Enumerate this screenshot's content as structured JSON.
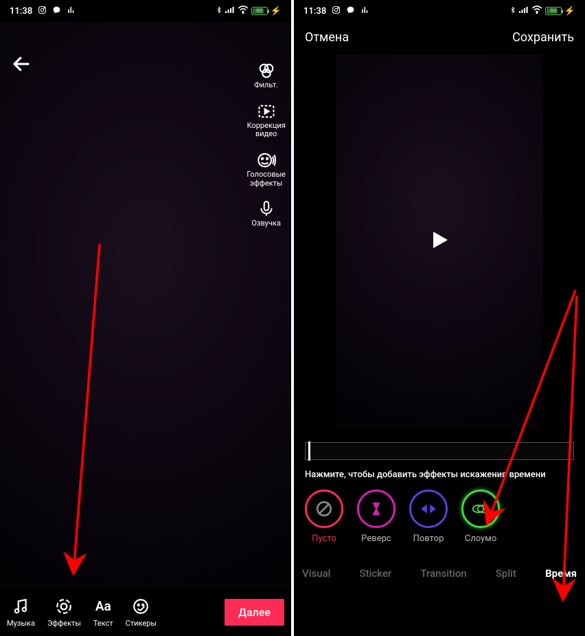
{
  "statusbar": {
    "time": "11:38",
    "battery": "80"
  },
  "left": {
    "side_tools": {
      "filters": "Фильт.",
      "correction": "Коррекция\nвидео",
      "voice_effects": "Голосовые\nэффекты",
      "voiceover": "Озвучка"
    },
    "bottom": {
      "music": "Музыка",
      "effects": "Эффекты",
      "text": "Текст",
      "stickers": "Стикеры",
      "next": "Далее"
    }
  },
  "right": {
    "header": {
      "cancel": "Отмена",
      "save": "Сохранить"
    },
    "hint": "Нажмите, чтобы добавить эффекты искажения времени",
    "effects": {
      "empty": "Пусто",
      "reverse": "Реверс",
      "repeat": "Повтор",
      "slomo": "Слоумо"
    },
    "tabs": {
      "visual": "Visual",
      "sticker": "Sticker",
      "transition": "Transition",
      "split": "Split",
      "time": "Время"
    }
  }
}
